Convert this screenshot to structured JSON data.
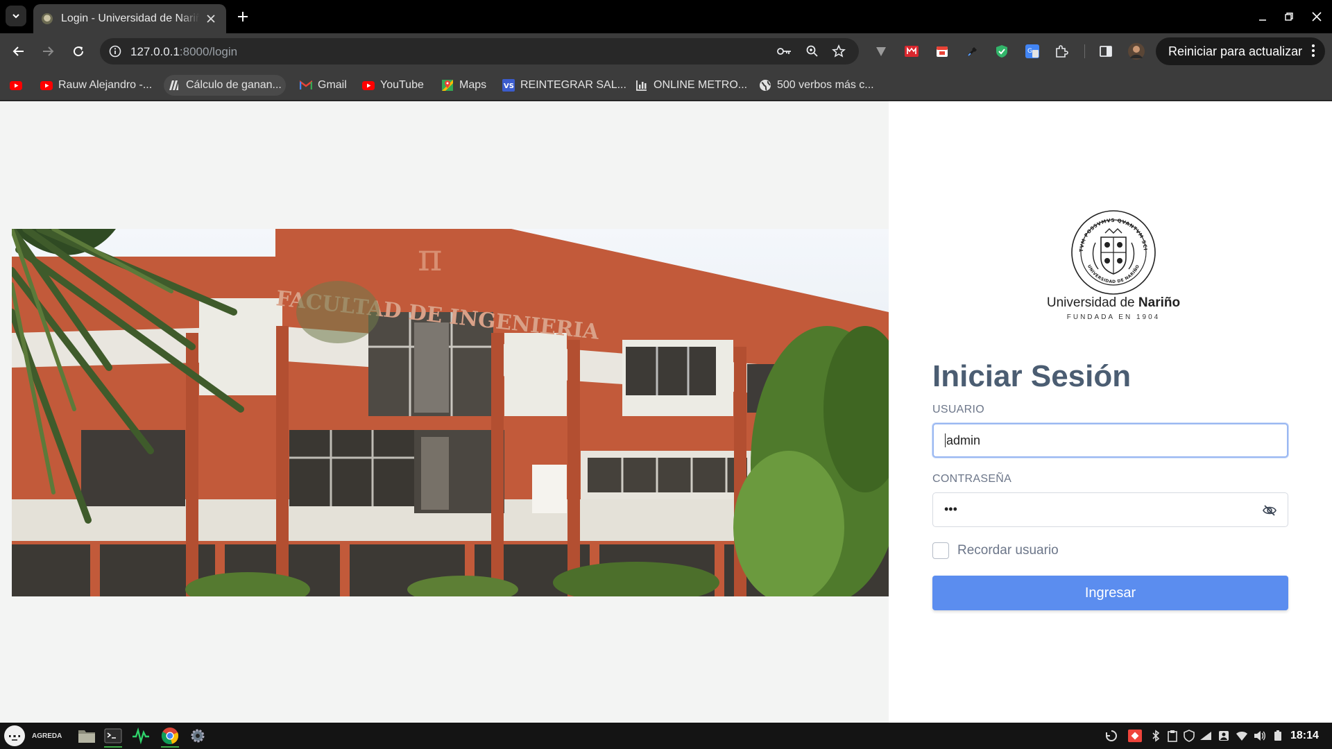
{
  "browser": {
    "tab_title": "Login - Universidad de Nariño",
    "url_host": "127.0.0.1",
    "url_path": ":8000/login",
    "relaunch_label": "Reiniciar para actualizar"
  },
  "bookmarks": [
    {
      "label": "",
      "icon": "youtube-icon"
    },
    {
      "label": "Rauw Alejandro -...",
      "icon": "youtube-icon"
    },
    {
      "label": "Cálculo de ganan...",
      "icon": "document-icon"
    },
    {
      "label": "Gmail",
      "icon": "gmail-icon"
    },
    {
      "label": "YouTube",
      "icon": "youtube-icon"
    },
    {
      "label": "Maps",
      "icon": "maps-icon"
    },
    {
      "label": "REINTEGRAR SAL...",
      "icon": "vs-icon"
    },
    {
      "label": "ONLINE METRO...",
      "icon": "chart-icon"
    },
    {
      "label": "500 verbos más c...",
      "icon": "globe-icon"
    }
  ],
  "login": {
    "university_name_regular": "Universidad de ",
    "university_name_bold": "Nariño",
    "university_subtitle": "FUNDADA EN 1904",
    "seal_motto": "TANTVM POSSVMVS QVANTVM SCIMVS",
    "seal_bottom": "UNIVERSIDAD DE NARIÑO",
    "photo_sign": "FACULTAD DE INGENIERIA",
    "title": "Iniciar Sesión",
    "username_label": "USUARIO",
    "username_value": "admin",
    "password_label": "CONTRASEÑA",
    "password_value": "•••",
    "remember_label": "Recordar usuario",
    "submit_label": "Ingresar"
  },
  "taskbar": {
    "username": "AGREDA",
    "clock": "18:14"
  },
  "colors": {
    "primary_button": "#5b8def",
    "title_text": "#4b5d72",
    "left_background": "#f3f4f3",
    "building_brick": "#c25a3a"
  }
}
